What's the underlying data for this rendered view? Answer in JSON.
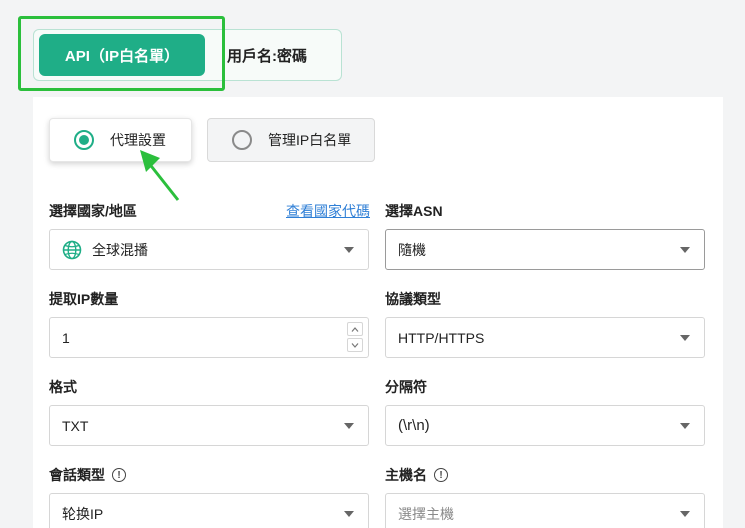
{
  "tabs": {
    "active_label": "API（IP白名單）",
    "inactive_label": "用戶名:密碼"
  },
  "mode": {
    "option1": "代理設置",
    "option2": "管理IP白名單"
  },
  "form": {
    "country_label": "選擇國家/地區",
    "country_link": "查看國家代碼",
    "country_value": "全球混播",
    "asn_label": "選擇ASN",
    "asn_value": "隨機",
    "quantity_label": "提取IP數量",
    "quantity_value": "1",
    "protocol_label": "協議類型",
    "protocol_value": "HTTP/HTTPS",
    "format_label": "格式",
    "format_value": "TXT",
    "separator_label": "分隔符",
    "separator_value": "(\\r\\n)",
    "session_label": "會話類型",
    "session_value": "轮换IP",
    "host_label": "主機名",
    "host_placeholder": "選擇主機"
  },
  "colors": {
    "accent": "#1fae87",
    "highlight": "#2bbf3c",
    "link": "#2f7fd6"
  }
}
